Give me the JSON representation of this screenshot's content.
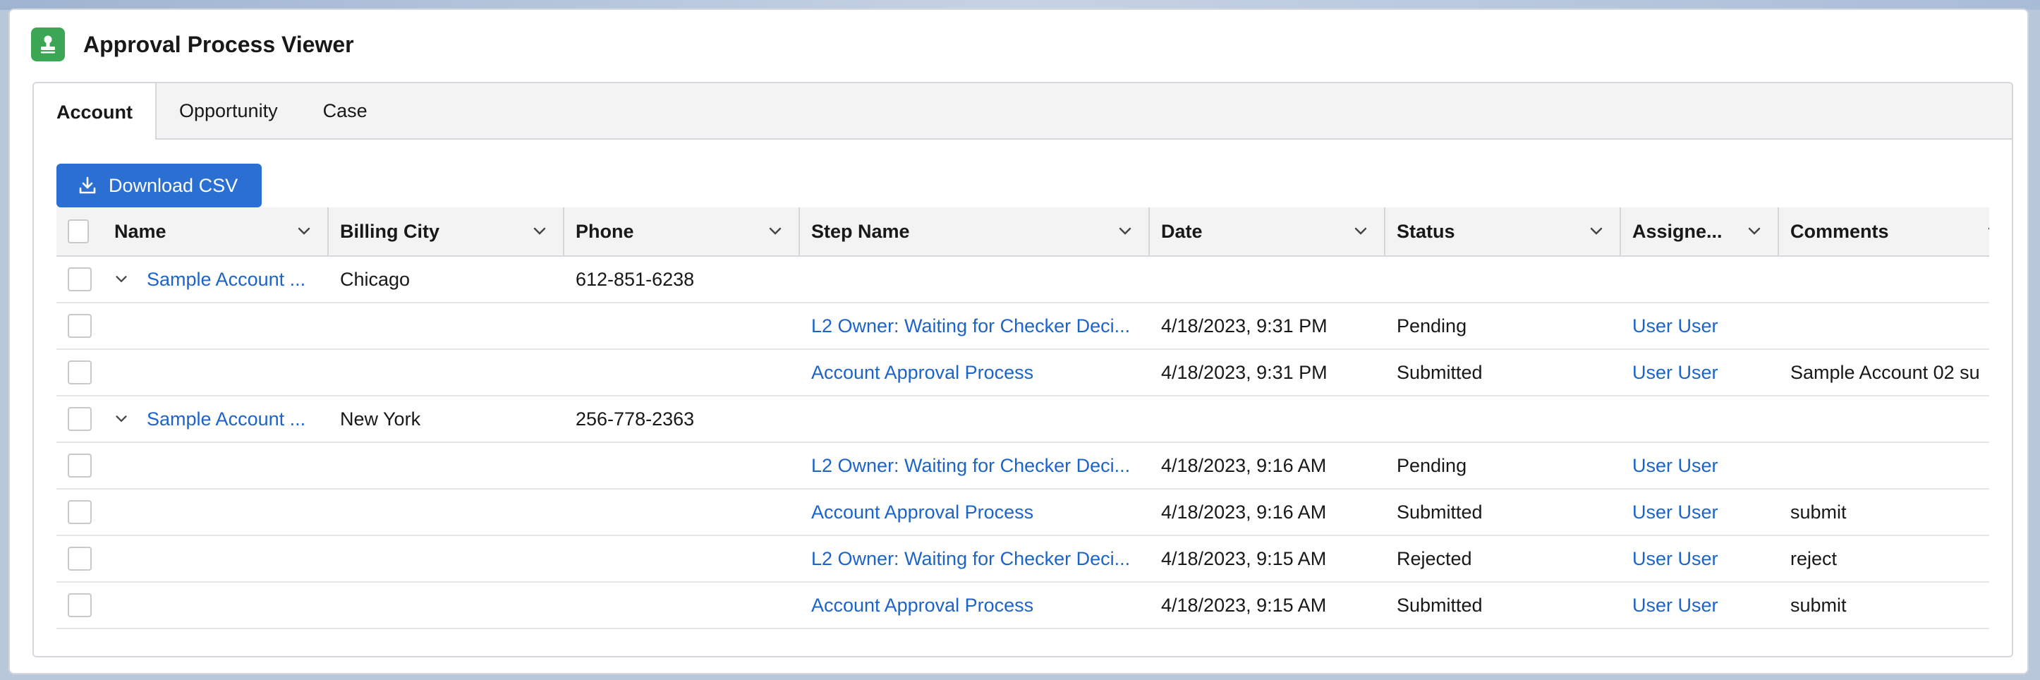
{
  "app": {
    "title": "Approval Process Viewer",
    "icon": "person-approval-icon",
    "accent_color": "#3ba755"
  },
  "tabs": [
    {
      "label": "Account",
      "active": true
    },
    {
      "label": "Opportunity",
      "active": false
    },
    {
      "label": "Case",
      "active": false
    }
  ],
  "toolbar": {
    "download_label": "Download CSV",
    "download_icon": "download-icon",
    "button_color": "#2b6fd3"
  },
  "table": {
    "columns": [
      "Name",
      "Billing City",
      "Phone",
      "Step Name",
      "Date",
      "Status",
      "Assigne...",
      "Comments"
    ],
    "rows": [
      {
        "type": "parent",
        "name": "Sample Account ...",
        "city": "Chicago",
        "phone": "612-851-6238",
        "step": "",
        "date": "",
        "status": "",
        "assignee": "",
        "comments": ""
      },
      {
        "type": "child",
        "name": "",
        "city": "",
        "phone": "",
        "step": "L2 Owner: Waiting for Checker Deci...",
        "date": "4/18/2023, 9:31 PM",
        "status": "Pending",
        "assignee": "User User",
        "comments": ""
      },
      {
        "type": "child",
        "name": "",
        "city": "",
        "phone": "",
        "step": "Account Approval Process",
        "date": "4/18/2023, 9:31 PM",
        "status": "Submitted",
        "assignee": "User User",
        "comments": "Sample Account 02 su"
      },
      {
        "type": "parent",
        "name": "Sample Account ...",
        "city": "New York",
        "phone": "256-778-2363",
        "step": "",
        "date": "",
        "status": "",
        "assignee": "",
        "comments": ""
      },
      {
        "type": "child",
        "name": "",
        "city": "",
        "phone": "",
        "step": "L2 Owner: Waiting for Checker Deci...",
        "date": "4/18/2023, 9:16 AM",
        "status": "Pending",
        "assignee": "User User",
        "comments": ""
      },
      {
        "type": "child",
        "name": "",
        "city": "",
        "phone": "",
        "step": "Account Approval Process",
        "date": "4/18/2023, 9:16 AM",
        "status": "Submitted",
        "assignee": "User User",
        "comments": "submit"
      },
      {
        "type": "child",
        "name": "",
        "city": "",
        "phone": "",
        "step": "L2 Owner: Waiting for Checker Deci...",
        "date": "4/18/2023, 9:15 AM",
        "status": "Rejected",
        "assignee": "User User",
        "comments": "reject"
      },
      {
        "type": "child",
        "name": "",
        "city": "",
        "phone": "",
        "step": "Account Approval Process",
        "date": "4/18/2023, 9:15 AM",
        "status": "Submitted",
        "assignee": "User User",
        "comments": "submit"
      }
    ]
  }
}
